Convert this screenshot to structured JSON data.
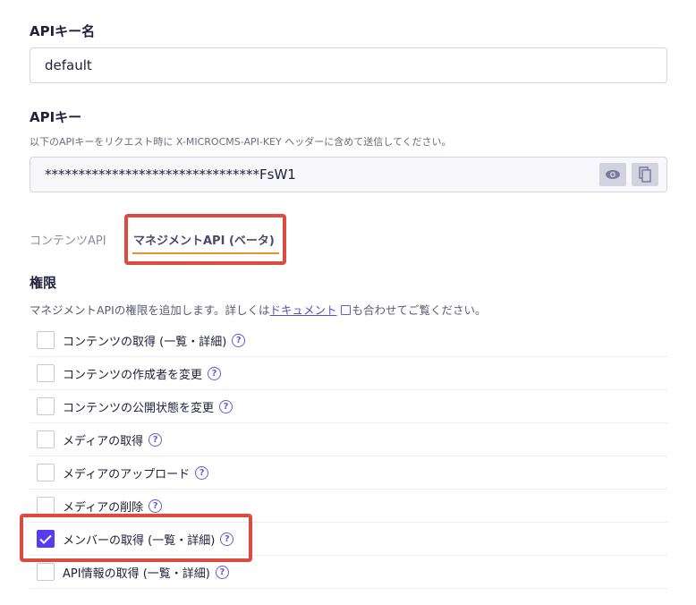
{
  "key_name": {
    "label": "APIキー名",
    "value": "default"
  },
  "api_key": {
    "label": "APIキー",
    "description": "以下のAPIキーをリクエスト時に X-MICROCMS-API-KEY ヘッダーに含めて送信してください。",
    "value": "********************************FsW1"
  },
  "tabs": [
    {
      "label": "コンテンツAPI",
      "active": false
    },
    {
      "label": "マネジメントAPI (ベータ)",
      "active": true
    }
  ],
  "permissions": {
    "title": "権限",
    "desc_before": "マネジメントAPIの権限を追加します。詳しくは",
    "doc_link": "ドキュメント",
    "desc_after": "も合わせてご覧ください。",
    "items": [
      {
        "label": "コンテンツの取得 (一覧・詳細)",
        "checked": false
      },
      {
        "label": "コンテンツの作成者を変更",
        "checked": false
      },
      {
        "label": "コンテンツの公開状態を変更",
        "checked": false
      },
      {
        "label": "メディアの取得",
        "checked": false
      },
      {
        "label": "メディアのアップロード",
        "checked": false
      },
      {
        "label": "メディアの削除",
        "checked": false
      },
      {
        "label": "メンバーの取得 (一覧・詳細)",
        "checked": true
      },
      {
        "label": "API情報の取得 (一覧・詳細)",
        "checked": false
      }
    ],
    "help": "?"
  },
  "colors": {
    "accent": "#5a3cf0",
    "tab_underline": "#e8912d",
    "highlight": "#dc4a40"
  }
}
